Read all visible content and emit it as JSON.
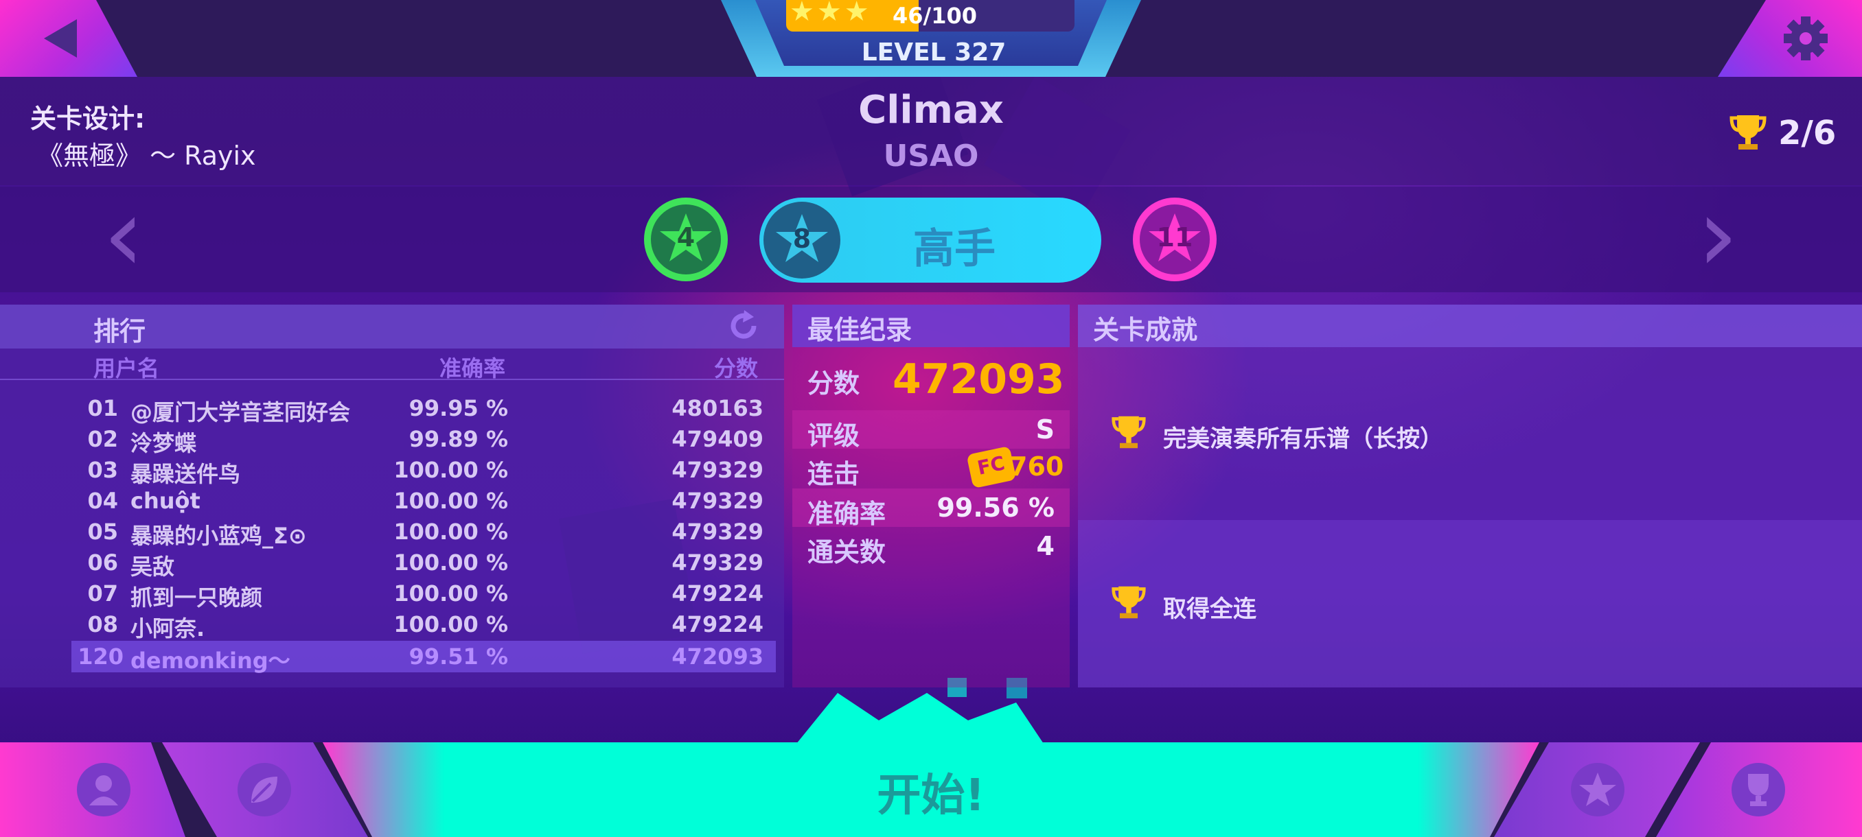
{
  "top": {
    "progress_text": "46/100",
    "progress_fraction": 0.46,
    "level_text": "LEVEL 327"
  },
  "header": {
    "designer_label": "关卡设计:",
    "designer_value": "《無極》 ～ Rayix",
    "song_title": "Climax",
    "song_artist": "USAO",
    "trophy_count": "2/6"
  },
  "difficulties": {
    "easy_level": "4",
    "selected_level": "8",
    "selected_label": "高手",
    "hard_level": "11"
  },
  "leaderboard": {
    "title": "排行",
    "columns": {
      "user": "用户名",
      "accuracy": "准确率",
      "score": "分数"
    },
    "rows": [
      {
        "rank": "01",
        "user": "@厦门大学音茎同好会",
        "accuracy": "99.95 %",
        "score": "480163"
      },
      {
        "rank": "02",
        "user": "泠梦蝶",
        "accuracy": "99.89 %",
        "score": "479409"
      },
      {
        "rank": "03",
        "user": "暴躁送件鸟",
        "accuracy": "100.00 %",
        "score": "479329"
      },
      {
        "rank": "04",
        "user": "chuột",
        "accuracy": "100.00 %",
        "score": "479329"
      },
      {
        "rank": "05",
        "user": "暴躁的小蓝鸡_Σ⊙",
        "accuracy": "100.00 %",
        "score": "479329"
      },
      {
        "rank": "06",
        "user": "吴敌",
        "accuracy": "100.00 %",
        "score": "479329"
      },
      {
        "rank": "07",
        "user": "抓到一只晚颜",
        "accuracy": "100.00 %",
        "score": "479224"
      },
      {
        "rank": "08",
        "user": "小阿奈.",
        "accuracy": "100.00 %",
        "score": "479224"
      }
    ],
    "self_row": {
      "rank": "120",
      "user": "demonking～",
      "accuracy": "99.51 %",
      "score": "472093"
    }
  },
  "best_record": {
    "title": "最佳纪录",
    "score_label": "分数",
    "score_value": "472093",
    "rank_label": "评级",
    "rank_value": "S",
    "combo_label": "连击",
    "combo_badge": "FC",
    "combo_value": "760",
    "accuracy_label": "准确率",
    "accuracy_value": "99.56 %",
    "clears_label": "通关数",
    "clears_value": "4"
  },
  "achievements": {
    "title": "关卡成就",
    "items": [
      {
        "text": "完美演奏所有乐谱（长按）"
      },
      {
        "text": "取得全连"
      }
    ]
  },
  "bottom": {
    "start_label": "开始!"
  },
  "colors": {
    "accent_cyan": "#00ffd8",
    "score_gold": "#ffb500",
    "easy_green": "#3fe35a",
    "hard_pink": "#ff3ad0"
  },
  "icons": [
    "back-arrow-icon",
    "gear-icon",
    "trophy-icon",
    "star-icon",
    "refresh-icon",
    "user-icon",
    "leaf-icon",
    "star-badge-icon",
    "trophy-badge-icon"
  ]
}
